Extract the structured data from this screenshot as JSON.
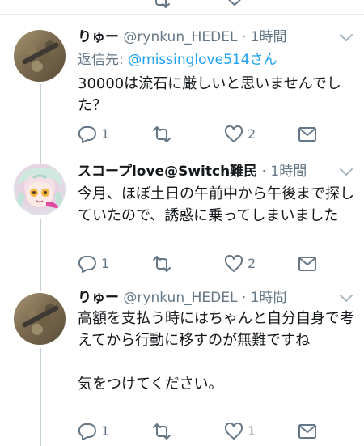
{
  "tweets": [
    {
      "name": "りゅー",
      "handle": "@rynkun_HEDEL",
      "time": "· 1時間",
      "reply_label": "返信先: ",
      "reply_to": "@missinglove514さん",
      "text": "30000は流石に厳しいと思いませんでした？",
      "replies": "1",
      "retweets": "",
      "likes": "2"
    },
    {
      "name": "スコープlove@Switch難民",
      "handle": "",
      "time": "· 1時間",
      "text": "今月、ほぼ土日の午前中から午後まで探していたので、誘惑に乗ってしまいました",
      "replies": "1",
      "retweets": "",
      "likes": "2"
    },
    {
      "name": "りゅー",
      "handle": "@rynkun_HEDEL",
      "time": "· 1時間",
      "text": "高額を支払う時にはちゃんと自分自身で考えてから行動に移すのが無難ですね\n\n気をつけてください。",
      "replies": "1",
      "retweets": "",
      "likes": "1"
    }
  ],
  "colors": {
    "text": "#14171a",
    "secondary": "#657786",
    "link": "#1da1f2",
    "divider": "#e6ecf0",
    "thread_line": "#c4cfd6"
  },
  "icons": [
    "reply-icon",
    "retweet-icon",
    "like-icon",
    "message-icon",
    "chevron-down-icon"
  ]
}
